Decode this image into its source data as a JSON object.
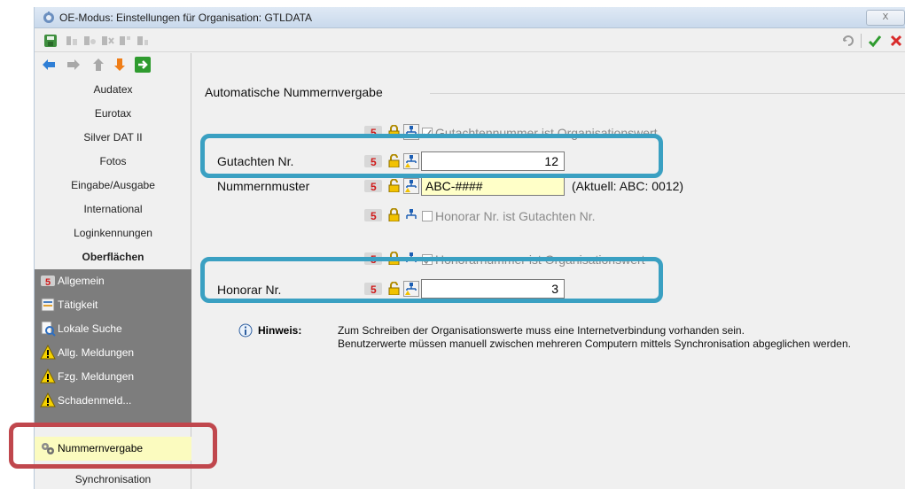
{
  "window": {
    "title": "OE-Modus: Einstellungen für Organisation: GTLDATA",
    "close_label": "X"
  },
  "toolbar": {
    "left_icons": [
      "save-icon",
      "tool-1-icon",
      "tool-2-icon",
      "tool-3-icon",
      "tool-4-icon",
      "tool-5-icon"
    ],
    "right_icons": [
      "refresh-icon",
      "check-icon",
      "close-icon"
    ]
  },
  "nav": {
    "arrows": [
      "arrow-left-icon",
      "arrow-right-icon",
      "arrow-up-icon",
      "arrow-down-icon",
      "exit-icon"
    ],
    "items": [
      {
        "label": "Audatex"
      },
      {
        "label": "Eurotax"
      },
      {
        "label": "Silver DAT II"
      },
      {
        "label": "Fotos"
      },
      {
        "label": "Eingabe/Ausgabe"
      },
      {
        "label": "International"
      },
      {
        "label": "Loginkennungen"
      },
      {
        "label": "Oberflächen"
      }
    ],
    "subitems": [
      {
        "label": "Allgemein",
        "icon": "kfz5-icon"
      },
      {
        "label": "Tätigkeit",
        "icon": "form-icon"
      },
      {
        "label": "Lokale Suche",
        "icon": "search-doc-icon"
      },
      {
        "label": "Allg. Meldungen",
        "icon": "warning-icon"
      },
      {
        "label": "Fzg. Meldungen",
        "icon": "warning-icon"
      },
      {
        "label": "Schadenmeld...",
        "icon": "warning-icon"
      },
      {
        "label": "Nummernvergabe",
        "icon": "gears-icon"
      }
    ],
    "bottom_item": "Synchronisation"
  },
  "content": {
    "section_title": "Automatische Nummernvergabe",
    "checkbox_org_gutachten": "Gutachtennummer ist Organisationswert",
    "gutachten_label": "Gutachten Nr.",
    "gutachten_value": "12",
    "nummernmuster_label": "Nummernmuster",
    "nummernmuster_value": "ABC-####",
    "nummernmuster_current": "(Aktuell: ABC: 0012)",
    "checkbox_honorar_ist_gutachten": "Honorar Nr. ist Gutachten Nr.",
    "checkbox_org_honorar": "Honorarnummer ist Organisationswert",
    "honorar_label": "Honorar Nr.",
    "honorar_value": "3",
    "hinweis_label": "Hinweis:",
    "hinweis_line1": "Zum Schreiben der Organisationswerte muss eine Internetverbindung vorhanden sein.",
    "hinweis_line2": "Benutzerwerte müssen manuell zwischen mehreren Computern mittels Synchronisation abgeglichen werden."
  },
  "colors": {
    "callout_blue": "#3aa0c2",
    "callout_red": "#c0474d",
    "subnav_bg": "#7d7d7d",
    "selected_bg": "#fbfbbf",
    "pattern_input_bg": "#ffffc8"
  }
}
